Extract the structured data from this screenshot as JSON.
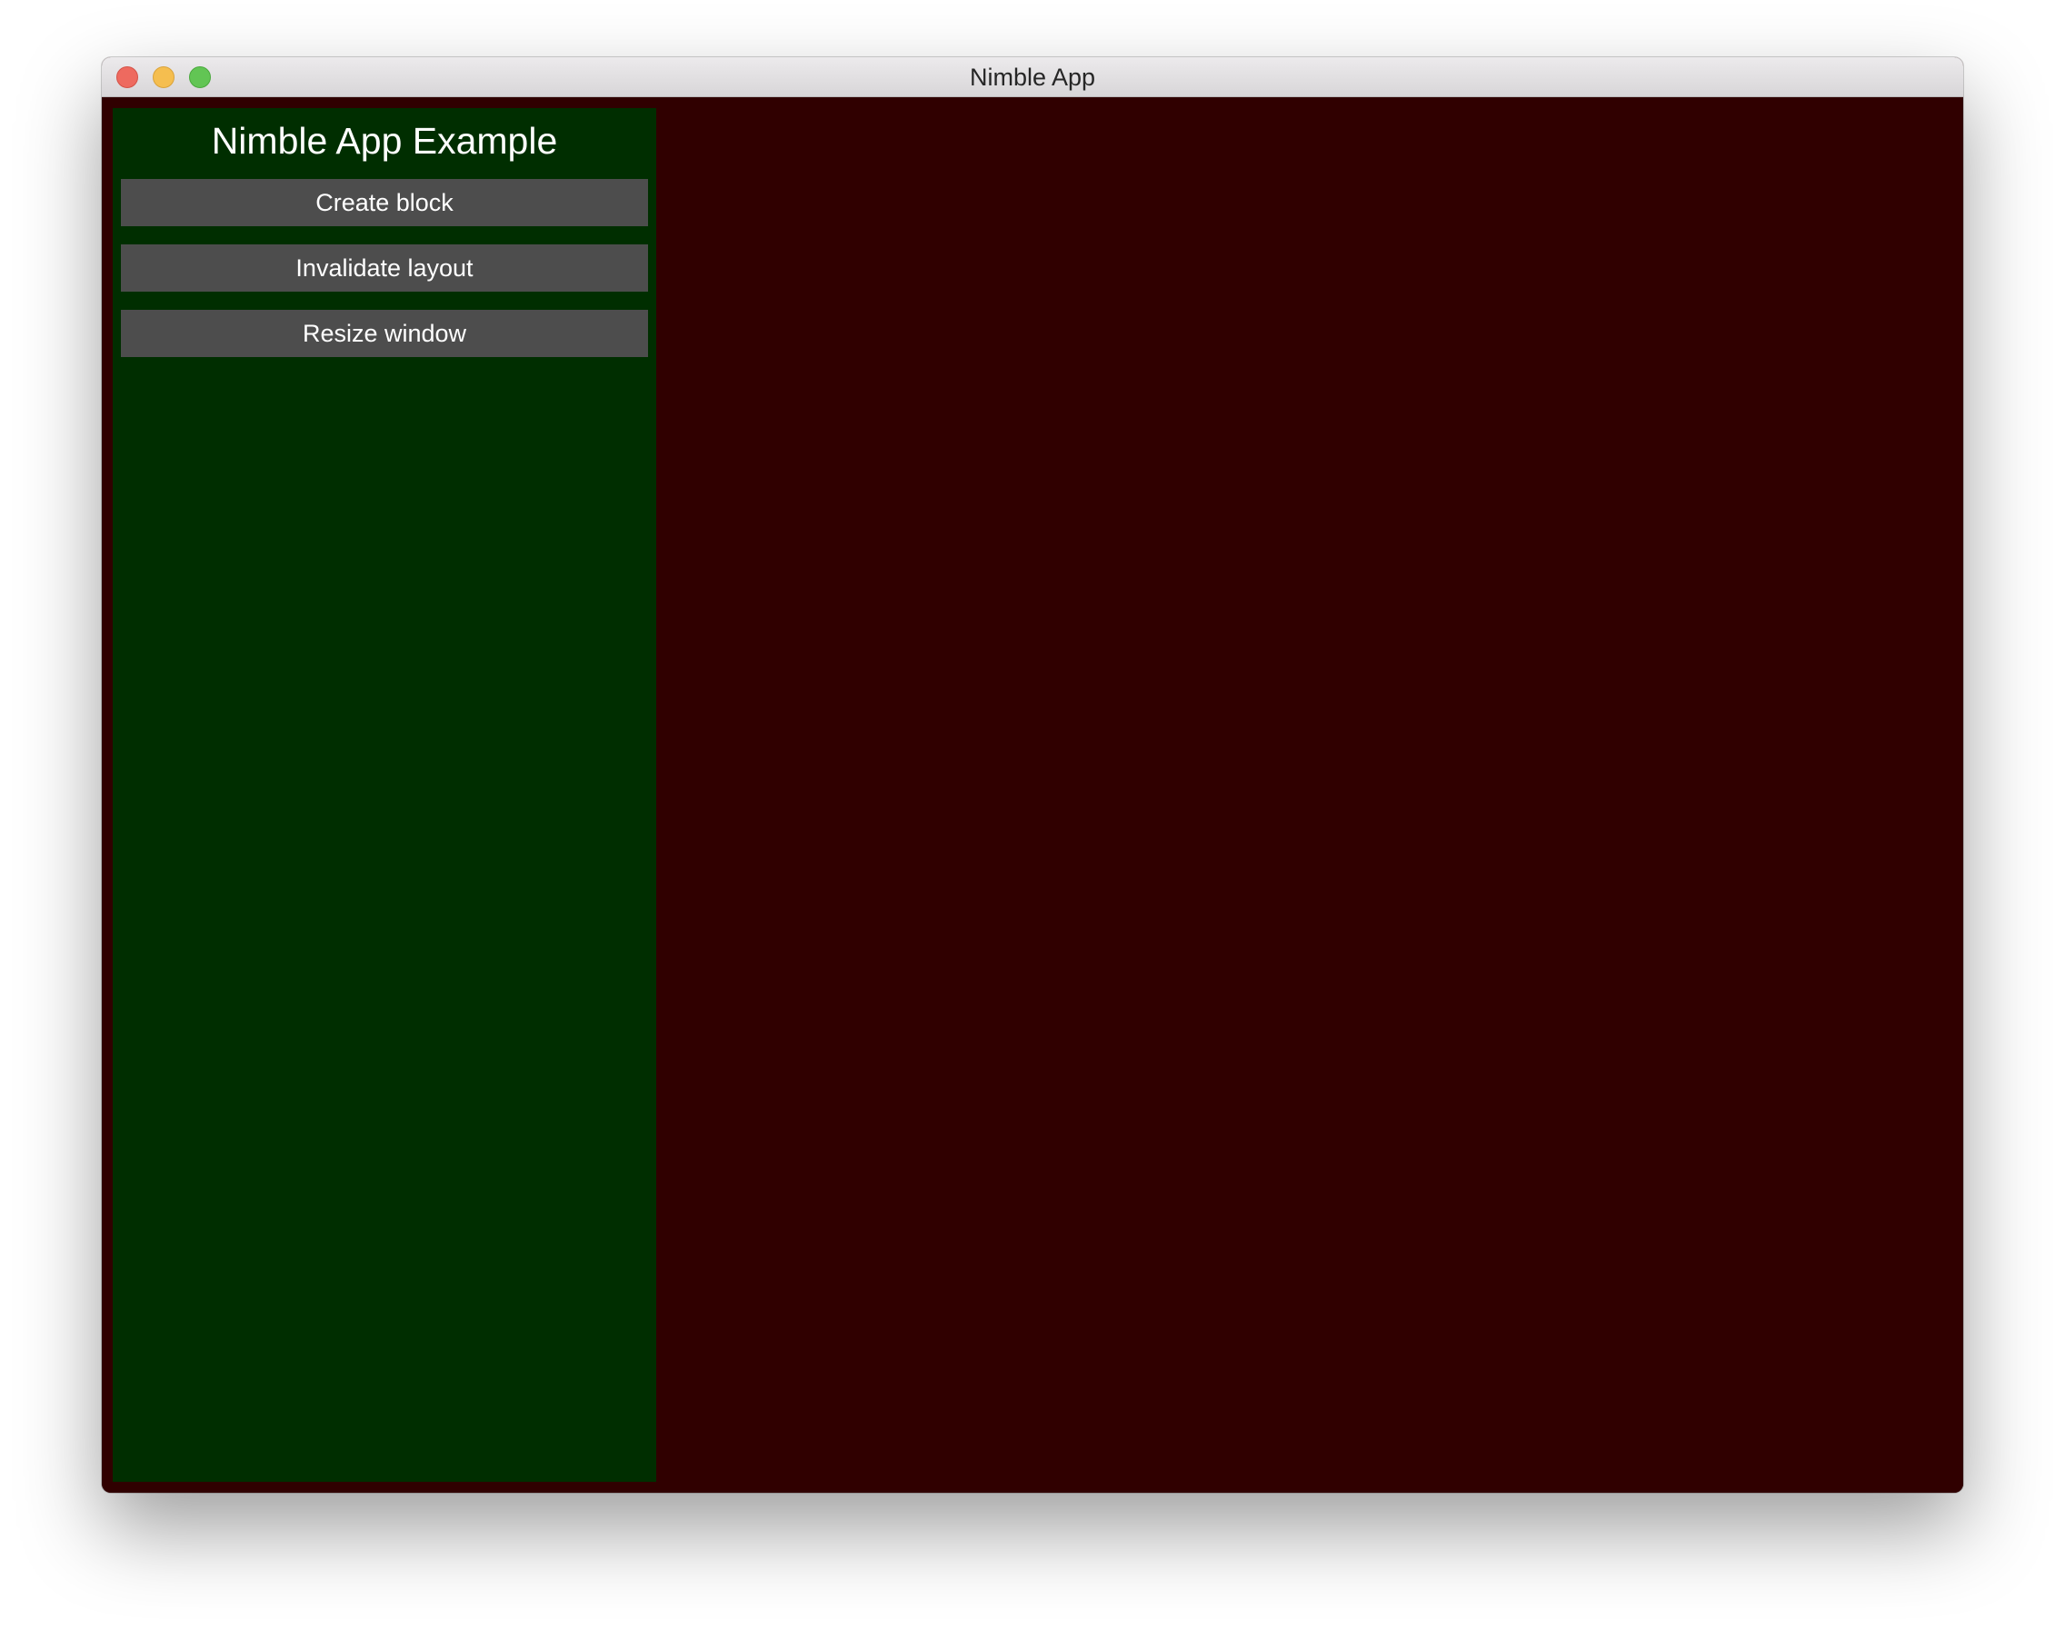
{
  "window": {
    "title": "Nimble App"
  },
  "sidebar": {
    "heading": "Nimble App Example",
    "buttons": [
      {
        "label": "Create block"
      },
      {
        "label": "Invalidate layout"
      },
      {
        "label": "Resize window"
      }
    ]
  },
  "colors": {
    "sidebar_background": "#002e00",
    "main_background": "#300000",
    "button_background": "#4d4d4d",
    "close": "#ee6a5f",
    "minimize": "#f5be4f",
    "zoom": "#62c554"
  }
}
